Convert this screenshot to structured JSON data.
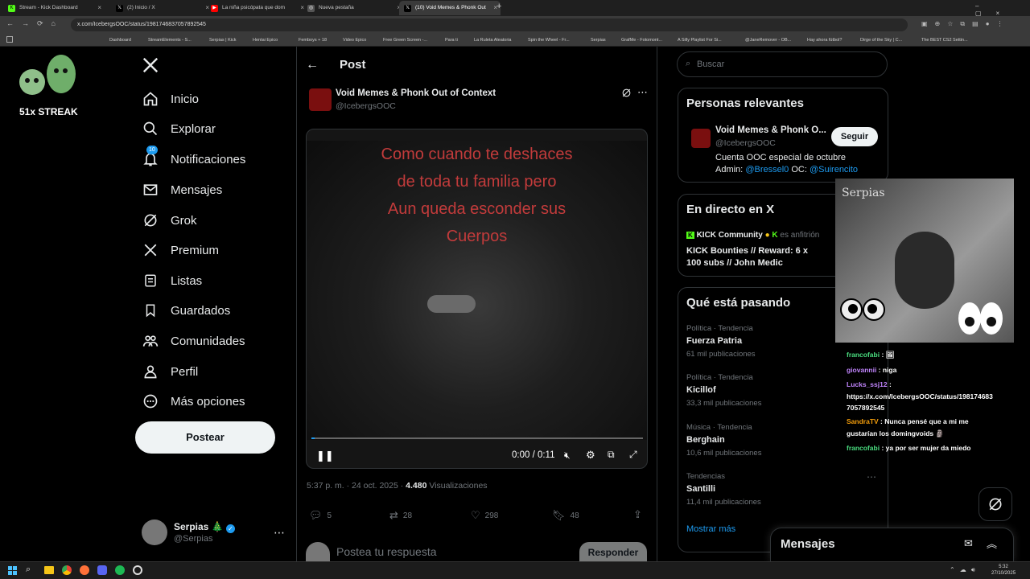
{
  "browser": {
    "tabs": [
      {
        "label": "Stream - Kick Dashboard",
        "color": "#53fc18",
        "glyph": "K"
      },
      {
        "label": "(2) Inicio / X",
        "color": "#000000",
        "glyph": "X"
      },
      {
        "label": "La niña psicópata que dom",
        "color": "#ff0000",
        "glyph": "▶"
      },
      {
        "label": "Nueva pestaña",
        "color": "#555555",
        "glyph": "◎"
      },
      {
        "label": "(10) Void Memes & Phonk Out",
        "color": "#000000",
        "glyph": "X"
      }
    ],
    "url": "x.com/IcebergsOOC/status/1981746837057892545",
    "bookmarks": [
      "Dashboard",
      "StreamElements - S...",
      "Serpias | Kick",
      "Hentai Epico",
      "Femboys + 18",
      "Video Epico",
      "Free Green Screen -...",
      "Para ti",
      "La Ruleta Aleatoria",
      "Spin the Wheel - Fr...",
      "Serpias",
      "GrafMe - Fotomont...",
      "A Silly Playlist For Si...",
      "@JaneRemover - OB...",
      "Hay ahora fútbol?",
      "Dirge of the Sky | C...",
      "The BEST CS2 Settin..."
    ]
  },
  "overlay": {
    "streak": "51x STREAK"
  },
  "nav": {
    "items": [
      {
        "label": "Inicio",
        "icon": "home-icon"
      },
      {
        "label": "Explorar",
        "icon": "search-icon"
      },
      {
        "label": "Notificaciones",
        "icon": "bell-icon",
        "badge": "10"
      },
      {
        "label": "Mensajes",
        "icon": "mail-icon"
      },
      {
        "label": "Grok",
        "icon": "grok-icon"
      },
      {
        "label": "Premium",
        "icon": "x-logo-icon"
      },
      {
        "label": "Listas",
        "icon": "list-icon"
      },
      {
        "label": "Guardados",
        "icon": "bookmark-icon"
      },
      {
        "label": "Comunidades",
        "icon": "people-icon"
      },
      {
        "label": "Perfil",
        "icon": "person-icon"
      },
      {
        "label": "Más opciones",
        "icon": "more-circle-icon"
      }
    ],
    "post_button": "Postear",
    "account": {
      "name": "Serpias 🎄",
      "handle": "@Serpias"
    }
  },
  "post": {
    "header": "Post",
    "author_name": "Void Memes & Phonk Out of Context",
    "author_handle": "@IcebergsOOC",
    "caption_lines": [
      "Como cuando te deshaces",
      "de toda tu familia pero",
      "Aun queda esconder sus",
      "Cuerpos"
    ],
    "time_display": "0:00 / 0:11",
    "progress": 0.01,
    "timestamp": "5:37 p. m. · 24 oct. 2025 ·",
    "views_count": "4.480",
    "views_label": "Visualizaciones",
    "replies": "5",
    "reposts": "28",
    "likes": "298",
    "bookmarks": "48",
    "reply_placeholder": "Postea tu respuesta",
    "reply_button": "Responder"
  },
  "sidebar": {
    "search_placeholder": "Buscar",
    "relevant": {
      "title": "Personas relevantes",
      "name": "Void Memes & Phonk O...",
      "handle": "@IcebergsOOC",
      "follow": "Seguir",
      "bio_line1": "Cuenta OOC especial de octubre",
      "bio_admin": "Admin:",
      "bio_admin_link": "@Bressel0",
      "bio_oc": "OC:",
      "bio_oc_link": "@Suirencito"
    },
    "live": {
      "title": "En directo en X",
      "host": "KICK Community",
      "host_role": "es anfitrión",
      "stream_title_1": "KICK Bounties // Reward: 6 x",
      "stream_title_2": "100 subs // John Medic"
    },
    "trends": {
      "title": "Qué está pasando",
      "items": [
        {
          "category": "Política · Tendencia",
          "name": "Fuerza Patria",
          "count": "61 mil publicaciones"
        },
        {
          "category": "Política · Tendencia",
          "name": "Kicillof",
          "count": "33,3 mil publicaciones"
        },
        {
          "category": "Música · Tendencia",
          "name": "Berghain",
          "count": "10,6 mil publicaciones"
        },
        {
          "category": "Tendencias",
          "name": "Santilli",
          "count": "11,4 mil publicaciones"
        }
      ],
      "show_more": "Mostrar más"
    },
    "messages": "Mensajes"
  },
  "stream_overlay": {
    "webcam_label": "Serpias",
    "chat": [
      {
        "user": "francofabi",
        "color": "#4ade80",
        "text": " : 🖼"
      },
      {
        "user": "giovannii",
        "color": "#c084fc",
        "text": " : niga"
      },
      {
        "user": "Lucks_ssj12",
        "color": "#c084fc",
        "text": " :"
      },
      {
        "user": "",
        "color": "#ffffff",
        "text": "https://x.com/IcebergsOOC/status/198174683"
      },
      {
        "user": "",
        "color": "#ffffff",
        "text": "7057892545"
      },
      {
        "user": "SandraTV",
        "color": "#f59e0b",
        "text": " : Nunca pensé que a mi me"
      },
      {
        "user": "",
        "color": "#ffffff",
        "text": "gustarían los domingvoids 🗿"
      },
      {
        "user": "francofabi",
        "color": "#4ade80",
        "text": " : ya por ser mujer da miedo"
      }
    ]
  },
  "taskbar": {
    "time": "5:32",
    "date": "27/10/2025"
  }
}
